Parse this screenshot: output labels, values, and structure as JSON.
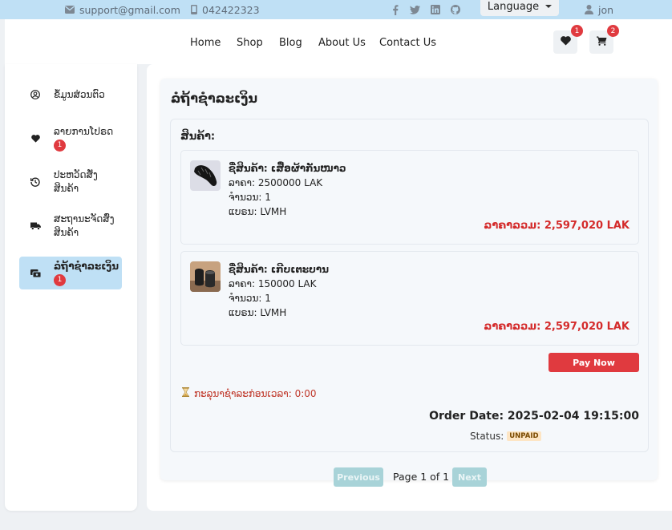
{
  "topbar": {
    "email": "support@gmail.com",
    "phone": "042422323",
    "language_label": "Language",
    "user_name": "jon",
    "social_icons": [
      "facebook-icon",
      "twitter-icon",
      "linkedin-icon",
      "github-icon"
    ]
  },
  "navbar": {
    "links": [
      "Home",
      "Shop",
      "Blog",
      "About Us",
      "Contact Us"
    ],
    "wishlist_count": "1",
    "cart_count": "2"
  },
  "sidebar": {
    "items": [
      {
        "label": "ຂໍ້ມູນສ່ວນຕົວ",
        "icon": "user-circle-icon"
      },
      {
        "label": "ລາຍການໂປຣດ",
        "icon": "heart-icon",
        "badge": "1"
      },
      {
        "label": "ປະຫວັດສັ່ງສິນຄ້າ",
        "icon": "history-icon"
      },
      {
        "label": "ສະຖານະຈັດສົ່ງ ສິນຄ້າ",
        "icon": "truck-icon"
      },
      {
        "label": "ລໍຖ້າຊໍາລະເງິນ",
        "icon": "payment-icon",
        "badge": "1",
        "active": true
      }
    ]
  },
  "panel": {
    "title": "ລໍຖ້າຊໍາລະເງິນ",
    "products_label": "ສິນຄ້າ:",
    "items": [
      {
        "name": "ຊື່ສິນຄ້າ: ເສື້ອຜ້າກັນໜາວ",
        "price": "ລາຄາ: 2500000 LAK",
        "qty": "ຈໍານວນ: 1",
        "brand": "ແບຣນ: LVMH",
        "total": "ລາຄາລວມ: 2,597,020 LAK"
      },
      {
        "name": "ຊື່ສິນຄ້າ: ເກີບເຕະບານ",
        "price": "ລາຄາ: 150000 LAK",
        "qty": "ຈໍານວນ: 1",
        "brand": "ແບຣນ: LVMH",
        "total": "ລາຄາລວມ: 2,597,020 LAK"
      }
    ],
    "pay_button": "Pay Now",
    "deadline": "ກະລຸນາຊໍາລະກ່ອນເວລາ: 0:00",
    "order_date": "Order Date: 2025-02-04 19:15:00",
    "status_label": "Status:",
    "status_value": "UNPAID",
    "pagination": {
      "previous": "Previous",
      "page_text": "Page 1 of 1",
      "next": "Next"
    }
  },
  "colors": {
    "topbar_bg": "#bfe0f5",
    "accent_red": "#e03a3f",
    "price_red": "#d42b2b",
    "pager_btn": "#a8d3d8",
    "active_sidebar": "#bfe0f5"
  }
}
